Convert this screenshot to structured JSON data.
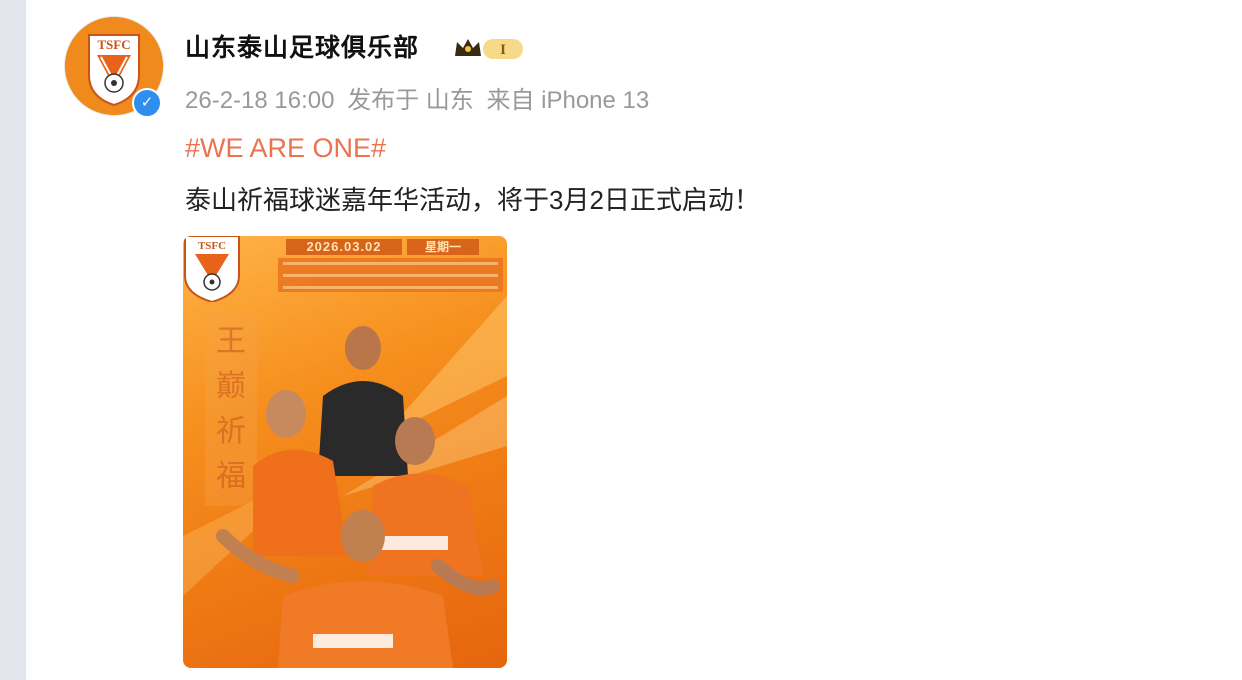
{
  "post": {
    "user_name": "山东泰山足球俱乐部",
    "vip_level": "I",
    "meta": {
      "time": "26-2-18 16:00",
      "location": "发布于 山东",
      "device": "来自 iPhone 13"
    },
    "hashtag": "#WE ARE ONE#",
    "text": "泰山祈福球迷嘉年华活动，将于3月2日正式启动！"
  },
  "poster": {
    "date": "2026.03.02",
    "weekday": "星期一"
  },
  "colors": {
    "hashtag": "#eb7350",
    "brand_orange": "#f08a1c",
    "verified_blue": "#2f8ff0"
  },
  "icons": {
    "verified": "verified-check-icon",
    "vip": "crown-icon"
  }
}
